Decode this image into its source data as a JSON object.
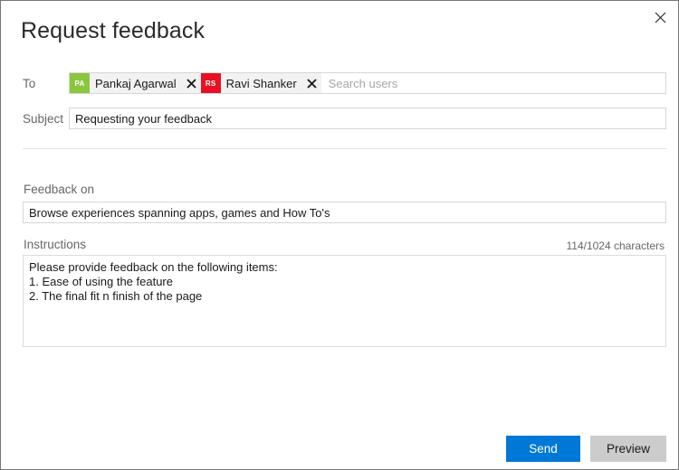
{
  "dialog": {
    "title": "Request feedback",
    "close_icon": "close-icon"
  },
  "to": {
    "label": "To",
    "placeholder": "Search users",
    "value": "",
    "recipients": [
      {
        "initials": "PA",
        "name": "Pankaj Agarwal",
        "color": "#8cc63e",
        "remove_icon": "close-icon"
      },
      {
        "initials": "RS",
        "name": "Ravi Shanker",
        "color": "#e81123",
        "remove_icon": "close-icon"
      }
    ]
  },
  "subject": {
    "label": "Subject",
    "value": "Requesting your feedback",
    "placeholder": ""
  },
  "feedback_on": {
    "label": "Feedback on",
    "value": "Browse experiences spanning apps, games and How To's",
    "placeholder": ""
  },
  "instructions": {
    "label": "Instructions",
    "counter": "114/1024 characters",
    "value": "Please provide feedback on the following items:\n1. Ease of using the feature\n2. The final fit n finish of the page",
    "placeholder": ""
  },
  "footer": {
    "send_label": "Send",
    "preview_label": "Preview"
  },
  "colors": {
    "accent": "#0078d7",
    "preview_button": "#cccccc",
    "border": "#d6d6d6",
    "label_text": "#666666"
  }
}
